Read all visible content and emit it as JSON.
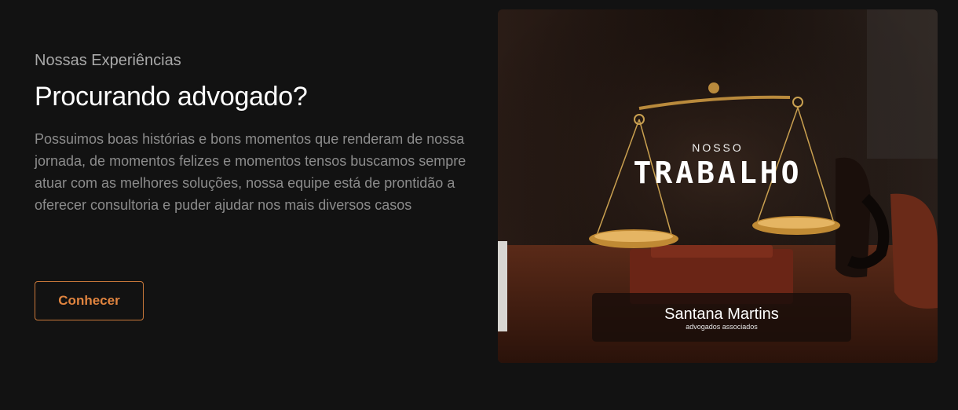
{
  "section": {
    "eyebrow": "Nossas Experiências",
    "title": "Procurando advogado?",
    "description": "Possuimos boas histórias e bons momentos que renderam de nossa jornada, de momentos felizes e momentos tensos buscamos sempre atuar com as melhores soluções, nossa equipe está de prontidão a oferecer consultoria e puder ajudar nos mais diversos casos",
    "cta_label": "Conhecer"
  },
  "feature_card": {
    "kicker": "NOSSO",
    "headline": "TRABALHO",
    "brand_name": "Santana Martins",
    "brand_tagline": "advogados associados",
    "image_subject": "scales-of-justice-photo"
  },
  "colors": {
    "background": "#121212",
    "accent": "#e0843f",
    "accent_border": "#c9783a",
    "heading": "#ffffff",
    "muted_text": "#8c8c8c"
  }
}
